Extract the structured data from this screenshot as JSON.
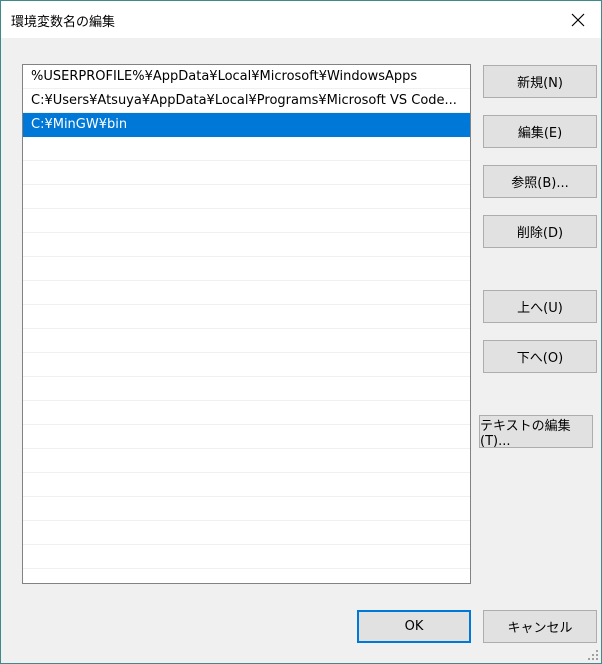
{
  "window": {
    "title": "環境変数名の編集"
  },
  "list": {
    "items": [
      "%USERPROFILE%¥AppData¥Local¥Microsoft¥WindowsApps",
      "C:¥Users¥Atsuya¥AppData¥Local¥Programs¥Microsoft VS Code...",
      "C:¥MinGW¥bin"
    ],
    "selected_index": 2
  },
  "buttons": {
    "new": "新規(N)",
    "edit": "編集(E)",
    "browse": "参照(B)...",
    "delete": "削除(D)",
    "up": "上へ(U)",
    "down": "下へ(O)",
    "edit_text": "テキストの編集(T)...",
    "ok": "OK",
    "cancel": "キャンセル"
  },
  "colors": {
    "selection": "#0078d7",
    "window_border": "#3e8a8a"
  }
}
